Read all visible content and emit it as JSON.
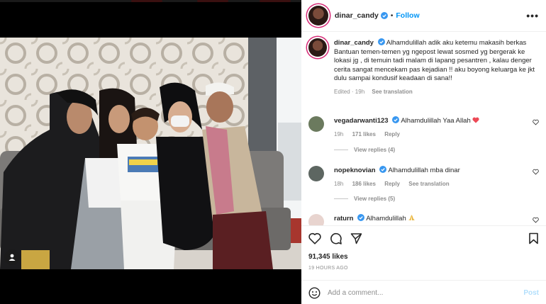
{
  "post": {
    "username": "dinar_candy",
    "follow_label": "Follow",
    "more_label": "•••",
    "caption": "Alhamdulillah adik aku ketemu makasih berkas Bantuan temen-temen yg ngepost lewat sosmed yg bergerak ke lokasi jg , di temuin tadi malam di lapang pesantren , kalau denger cerita sangat mencekam pas kejadian !! aku boyong keluarga ke jkt dulu sampai kondusif keadaan di sana!!",
    "caption_edited": "Edited · 19h",
    "see_translation": "See translation",
    "likes": "91,345 likes",
    "time_ago": "19 HOURS AGO",
    "comment_placeholder": "Add a comment...",
    "post_label": "Post"
  },
  "comments": [
    {
      "username": "vegadarwanti123",
      "text": "Alhamdulillah Yaa Allah",
      "emoji": "heart",
      "time": "19h",
      "likes": "171 likes",
      "reply": "Reply",
      "view_replies": "View replies (4)"
    },
    {
      "username": "nopeknovian",
      "text": "Alhamdulillah mba dinar",
      "time": "18h",
      "likes": "186 likes",
      "reply": "Reply",
      "see_translation": "See translation",
      "view_replies": "View replies (5)"
    },
    {
      "username": "raturn",
      "text": "Alhamdulillah",
      "emoji": "praying-hands"
    }
  ],
  "colors": {
    "accent": "#0095f6",
    "verified": "#3897f0",
    "heart": "#ed4956"
  }
}
